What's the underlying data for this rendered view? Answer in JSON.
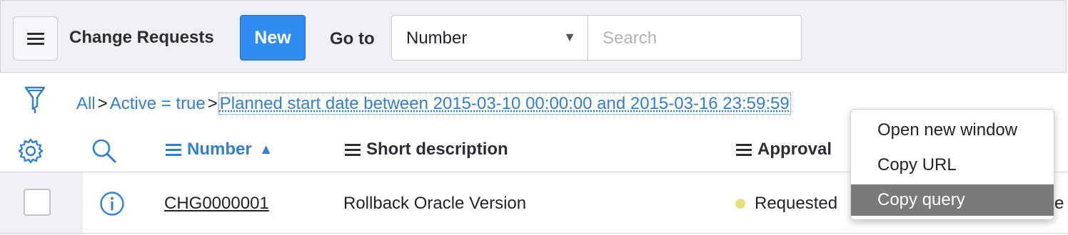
{
  "header": {
    "title": "Change Requests",
    "new_label": "New",
    "goto_label": "Go to",
    "goto_select_value": "Number",
    "search_placeholder": "Search"
  },
  "breadcrumb": {
    "items": [
      "All",
      "Active = true",
      "Planned start date between 2015-03-10 00:00:00 and 2015-03-16 23:59:59"
    ],
    "separator": ">"
  },
  "columns": {
    "number": "Number",
    "short_description": "Short description",
    "approval": "Approval"
  },
  "rows": [
    {
      "number": "CHG0000001",
      "short_description": "Rollback Oracle Version",
      "approval": "Requested",
      "overflow_text": "e"
    }
  ],
  "context_menu": {
    "items": [
      "Open new window",
      "Copy URL",
      "Copy query"
    ],
    "highlighted": "Copy query"
  },
  "colors": {
    "accent": "#2f8cf0",
    "link": "#2f7fd6",
    "status_requested": "#e6e07a",
    "menu_highlight": "#7a7a7a"
  },
  "icons": [
    "menu-icon",
    "filter-icon",
    "gear-icon",
    "search-icon",
    "info-icon",
    "sort-ascending-icon"
  ]
}
